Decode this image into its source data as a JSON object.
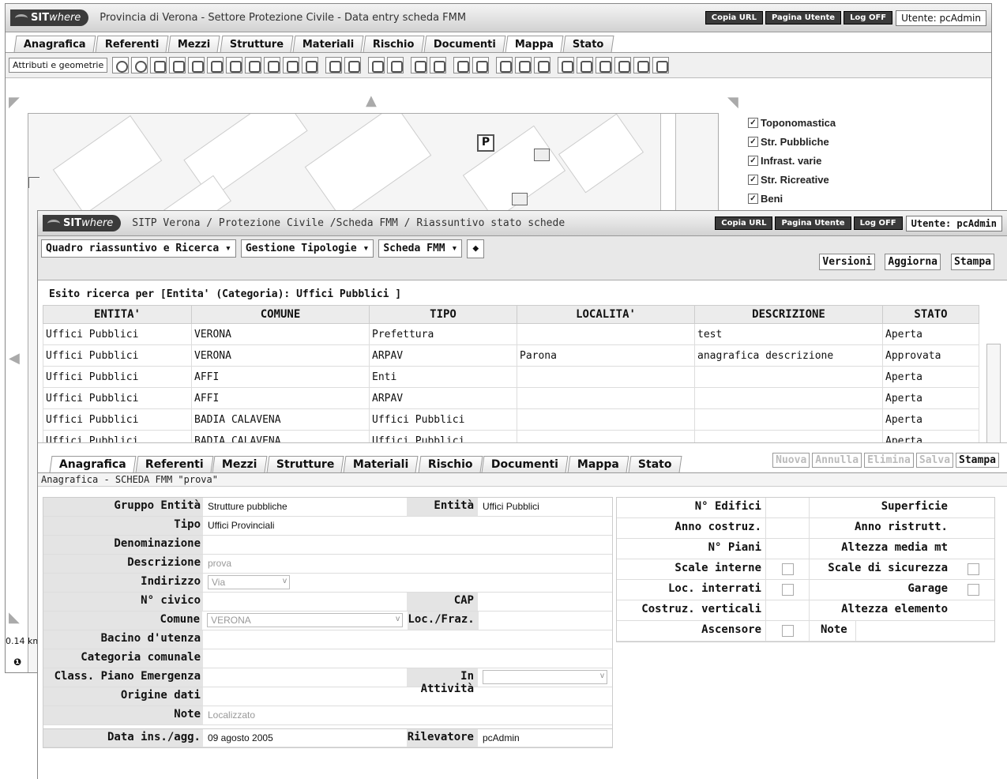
{
  "back": {
    "logo": "SIT",
    "logo_italic": "where",
    "title": "Provincia di Verona - Settore Protezione Civile - Data entry scheda FMM",
    "buttons": {
      "copy_url": "Copia URL",
      "user_page": "Pagina Utente",
      "logoff": "Log OFF"
    },
    "user": "Utente: pcAdmin",
    "tabs": [
      "Anagrafica",
      "Referenti",
      "Mezzi",
      "Strutture",
      "Materiali",
      "Rischio",
      "Documenti",
      "Mappa",
      "Stato"
    ],
    "active_tab": "Mappa",
    "toolbar_select": "Attributi e geometrie",
    "layers": [
      "Toponomastica",
      "Str. Pubbliche",
      "Infrast. varie",
      "Str. Ricreative",
      "Beni"
    ],
    "scale_text": "0.14 km",
    "map_symbol": "P"
  },
  "front": {
    "logo": "SIT",
    "logo_italic": "where",
    "title": "SITP Verona / Protezione Civile /Scheda FMM / Riassuntivo stato schede",
    "buttons": {
      "copy_url": "Copia URL",
      "user_page": "Pagina Utente",
      "logoff": "Log OFF"
    },
    "user": "Utente: pcAdmin",
    "menus": [
      "Quadro riassuntivo e Ricerca",
      "Gestione Tipologie",
      "Scheda FMM"
    ],
    "right_buttons": {
      "versions": "Versioni",
      "refresh": "Aggiorna",
      "print": "Stampa"
    },
    "results_title": "Esito ricerca per [Entita' (Categoria): Uffici Pubblici ]",
    "columns": [
      "ENTITA'",
      "COMUNE",
      "TIPO",
      "LOCALITA'",
      "DESCRIZIONE",
      "STATO"
    ],
    "rows": [
      [
        "Uffici Pubblici",
        "VERONA",
        "Prefettura",
        "",
        "test",
        "Aperta"
      ],
      [
        "Uffici Pubblici",
        "VERONA",
        "ARPAV",
        "Parona",
        "anagrafica descrizione",
        "Approvata"
      ],
      [
        "Uffici Pubblici",
        "AFFI",
        "Enti",
        "",
        "",
        "Aperta"
      ],
      [
        "Uffici Pubblici",
        "AFFI",
        "ARPAV",
        "",
        "",
        "Aperta"
      ],
      [
        "Uffici Pubblici",
        "BADIA CALAVENA",
        "Uffici Pubblici",
        "",
        "",
        "Aperta"
      ],
      [
        "Uffici Pubblici",
        "BADIA CALAVENA",
        "Uffici Pubblici",
        "",
        "",
        "Aperta"
      ]
    ],
    "tabs": [
      "Anagrafica",
      "Referenti",
      "Mezzi",
      "Strutture",
      "Materiali",
      "Rischio",
      "Documenti",
      "Mappa",
      "Stato"
    ],
    "active_tab": "Anagrafica",
    "actions": {
      "new": "Nuova",
      "cancel": "Annulla",
      "delete": "Elimina",
      "save": "Salva",
      "print": "Stampa"
    },
    "subtitle": "Anagrafica - SCHEDA FMM \"prova\"",
    "form": {
      "gruppo_label": "Gruppo Entità",
      "gruppo_value": "Strutture pubbliche",
      "entita_label": "Entità",
      "entita_value": "Uffici Pubblici",
      "tipo_label": "Tipo",
      "tipo_value": "Uffici Provinciali",
      "denominazione_label": "Denominazione",
      "descrizione_label": "Descrizione",
      "descrizione_value": "prova",
      "indirizzo_label": "Indirizzo",
      "indirizzo_value": "Via",
      "civico_label": "N° civico",
      "cap_label": "CAP",
      "comune_label": "Comune",
      "comune_value": "VERONA",
      "loc_label": "Loc./Fraz.",
      "bacino_label": "Bacino d'utenza",
      "categoria_label": "Categoria comunale",
      "class_label": "Class. Piano Emergenza",
      "attivita_label": "In Attività",
      "origine_label": "Origine dati",
      "note_label": "Note",
      "note_value": "Localizzato",
      "data_label": "Data ins./agg.",
      "data_value": "09 agosto 2005",
      "rilevatore_label": "Rilevatore",
      "rilevatore_value": "pcAdmin"
    },
    "details": {
      "edifici": "N° Edifici",
      "superficie": "Superficie",
      "anno_costr": "Anno costruz.",
      "anno_ristr": "Anno ristrutt.",
      "piani": "N° Piani",
      "altezza_media": "Altezza media mt",
      "scale_interne": "Scale interne",
      "scale_sicurezza": "Scale di sicurezza",
      "loc_interrati": "Loc. interrati",
      "garage": "Garage",
      "costruz_verticali": "Costruz. verticali",
      "altezza_elemento": "Altezza elemento",
      "ascensore": "Ascensore",
      "note": "Note"
    }
  }
}
